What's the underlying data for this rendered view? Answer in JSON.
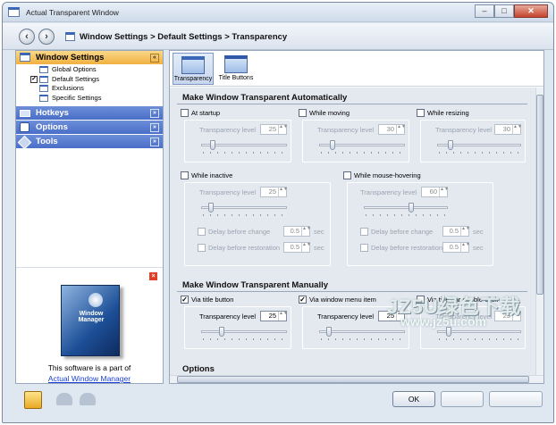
{
  "window": {
    "title": "Actual Transparent Window"
  },
  "nav": {
    "breadcrumb": "Window Settings > Default Settings > Transparency",
    "back_symbol": "‹",
    "forward_symbol": "›"
  },
  "sidebar": {
    "sections": [
      {
        "label": "Window Settings",
        "expanded": true
      },
      {
        "label": "Hotkeys",
        "expanded": false
      },
      {
        "label": "Options",
        "expanded": false
      },
      {
        "label": "Tools",
        "expanded": false
      }
    ],
    "items": [
      {
        "label": "Global Options"
      },
      {
        "label": "Default Settings",
        "checked": true
      },
      {
        "label": "Exclusions"
      },
      {
        "label": "Specific Settings"
      }
    ],
    "chevron_up": "«",
    "chevron_down": "»"
  },
  "promo": {
    "close": "×",
    "box_label": "Window Manager",
    "line1": "This software is a part of",
    "link": "Actual Window Manager"
  },
  "tabs": [
    {
      "label": "Transparency",
      "selected": true
    },
    {
      "label": "Title Buttons",
      "selected": false
    }
  ],
  "auto": {
    "title": "Make Window Transparent Automatically",
    "at_startup": {
      "label": "At startup",
      "level_label": "Transparency level",
      "value": "25"
    },
    "while_moving": {
      "label": "While moving",
      "level_label": "Transparency level",
      "value": "30"
    },
    "while_resizing": {
      "label": "While resizing",
      "level_label": "Transparency level",
      "value": "30"
    },
    "while_inactive": {
      "label": "While inactive",
      "level_label": "Transparency level",
      "value": "25",
      "delay_change": "Delay before change",
      "delay_change_val": "0.5",
      "delay_restore": "Delay before restoration",
      "delay_restore_val": "0.5",
      "unit": "sec"
    },
    "while_hover": {
      "label": "While mouse-hovering",
      "level_label": "Transparency level",
      "value": "60",
      "delay_change": "Delay before change",
      "delay_change_val": "0.5",
      "delay_restore": "Delay before restoration",
      "delay_restore_val": "0.5",
      "unit": "sec"
    }
  },
  "manual": {
    "title": "Make Window Transparent Manually",
    "via_title_button": {
      "label": "Via title button",
      "checked": true,
      "level_label": "Transparency level",
      "value": "25"
    },
    "via_window_menu": {
      "label": "Via window menu item",
      "checked": true,
      "level_label": "Transparency level",
      "value": "25"
    },
    "via_double_click": {
      "label": "Via title bar double-click",
      "checked": false,
      "level_label": "Transparency level",
      "value": "25"
    }
  },
  "options_title": "Options",
  "buttons": {
    "ok": "OK"
  },
  "checkmark": "✓",
  "spin_arrows": "▲▼",
  "watermark": {
    "line1": "JZ5U绿色下载",
    "line2": "www.jz5u.com"
  }
}
